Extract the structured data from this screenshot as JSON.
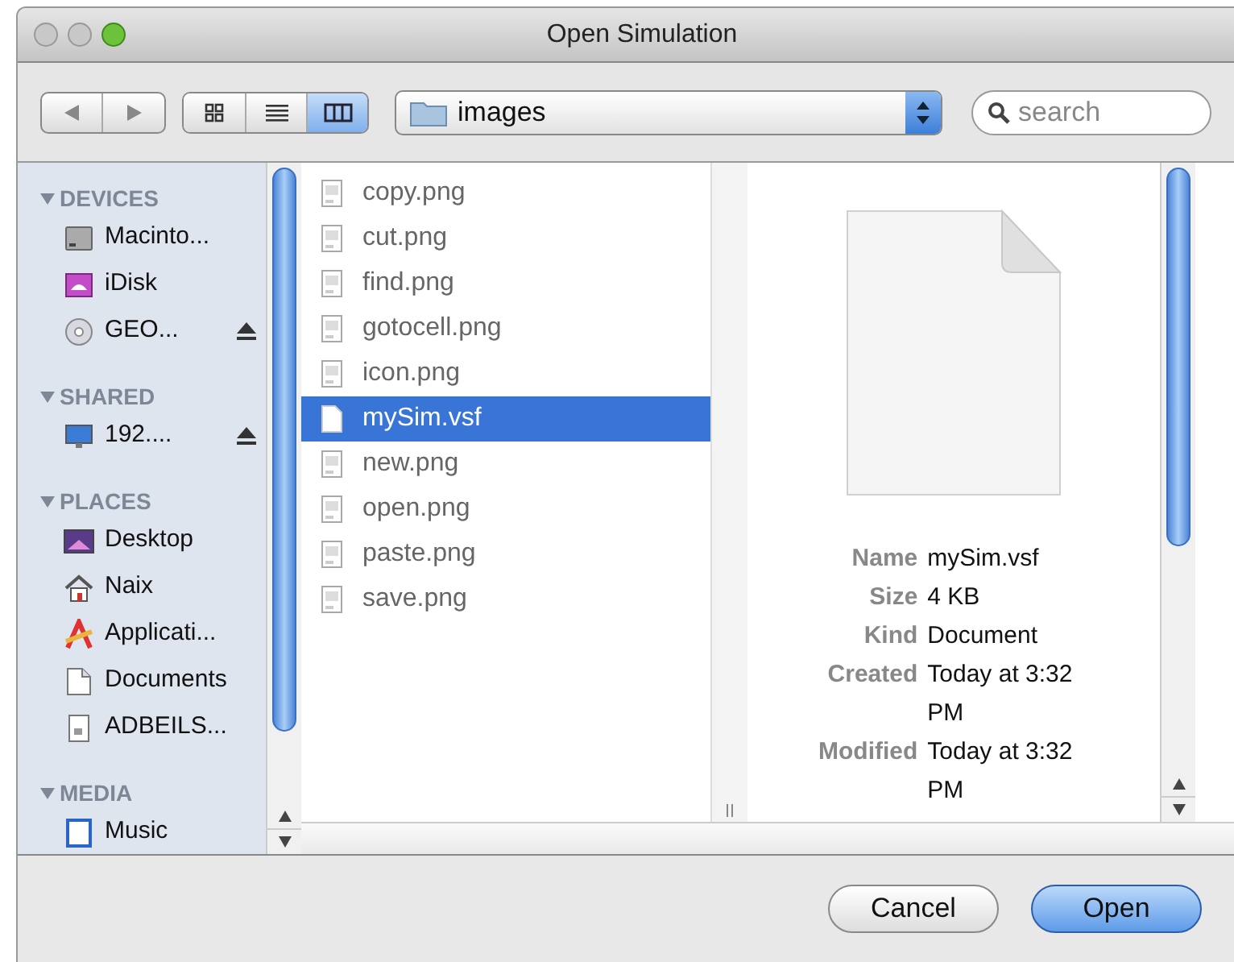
{
  "window": {
    "title": "Open Simulation"
  },
  "toolbar": {
    "view_modes": [
      {
        "kind": "icons",
        "selected": false
      },
      {
        "kind": "list",
        "selected": false
      },
      {
        "kind": "columns",
        "selected": true
      }
    ],
    "location": "images",
    "search": {
      "placeholder": "search"
    }
  },
  "sidebar": {
    "sections": [
      {
        "title": "DEVICES",
        "expanded": true,
        "items": [
          {
            "label": "Macinto...",
            "kind": "disk",
            "eject": false
          },
          {
            "label": "iDisk",
            "kind": "idisk",
            "eject": false
          },
          {
            "label": "GEO...",
            "kind": "cd",
            "eject": true
          }
        ]
      },
      {
        "title": "SHARED",
        "expanded": true,
        "items": [
          {
            "label": "192....",
            "kind": "monitor",
            "eject": true
          }
        ]
      },
      {
        "title": "PLACES",
        "expanded": true,
        "items": [
          {
            "label": "Desktop",
            "kind": "desktop",
            "eject": false
          },
          {
            "label": "Naix",
            "kind": "home",
            "eject": false
          },
          {
            "label": "Applicati...",
            "kind": "apps",
            "eject": false
          },
          {
            "label": "Documents",
            "kind": "documents",
            "eject": false
          },
          {
            "label": "ADBEILS...",
            "kind": "file",
            "eject": false
          }
        ]
      },
      {
        "title": "MEDIA",
        "expanded": true,
        "items": [
          {
            "label": "Music",
            "kind": "music",
            "eject": false
          }
        ]
      }
    ]
  },
  "files": [
    {
      "name": "copy.png",
      "kind": "image",
      "selected": false
    },
    {
      "name": "cut.png",
      "kind": "image",
      "selected": false
    },
    {
      "name": "find.png",
      "kind": "image",
      "selected": false
    },
    {
      "name": "gotocell.png",
      "kind": "image",
      "selected": false
    },
    {
      "name": "icon.png",
      "kind": "image",
      "selected": false
    },
    {
      "name": "mySim.vsf",
      "kind": "document",
      "selected": true
    },
    {
      "name": "new.png",
      "kind": "image",
      "selected": false
    },
    {
      "name": "open.png",
      "kind": "image",
      "selected": false
    },
    {
      "name": "paste.png",
      "kind": "image",
      "selected": false
    },
    {
      "name": "save.png",
      "kind": "image",
      "selected": false
    }
  ],
  "preview": {
    "fields": [
      {
        "label": "Name",
        "value": "mySim.vsf"
      },
      {
        "label": "Size",
        "value": "4 KB"
      },
      {
        "label": "Kind",
        "value": "Document"
      },
      {
        "label": "Created",
        "value": "Today at 3:32 PM"
      },
      {
        "label": "Modified",
        "value": "Today at 3:32 PM"
      }
    ]
  },
  "buttons": [
    {
      "label": "Cancel",
      "default": false
    },
    {
      "label": "Open",
      "default": true
    }
  ]
}
